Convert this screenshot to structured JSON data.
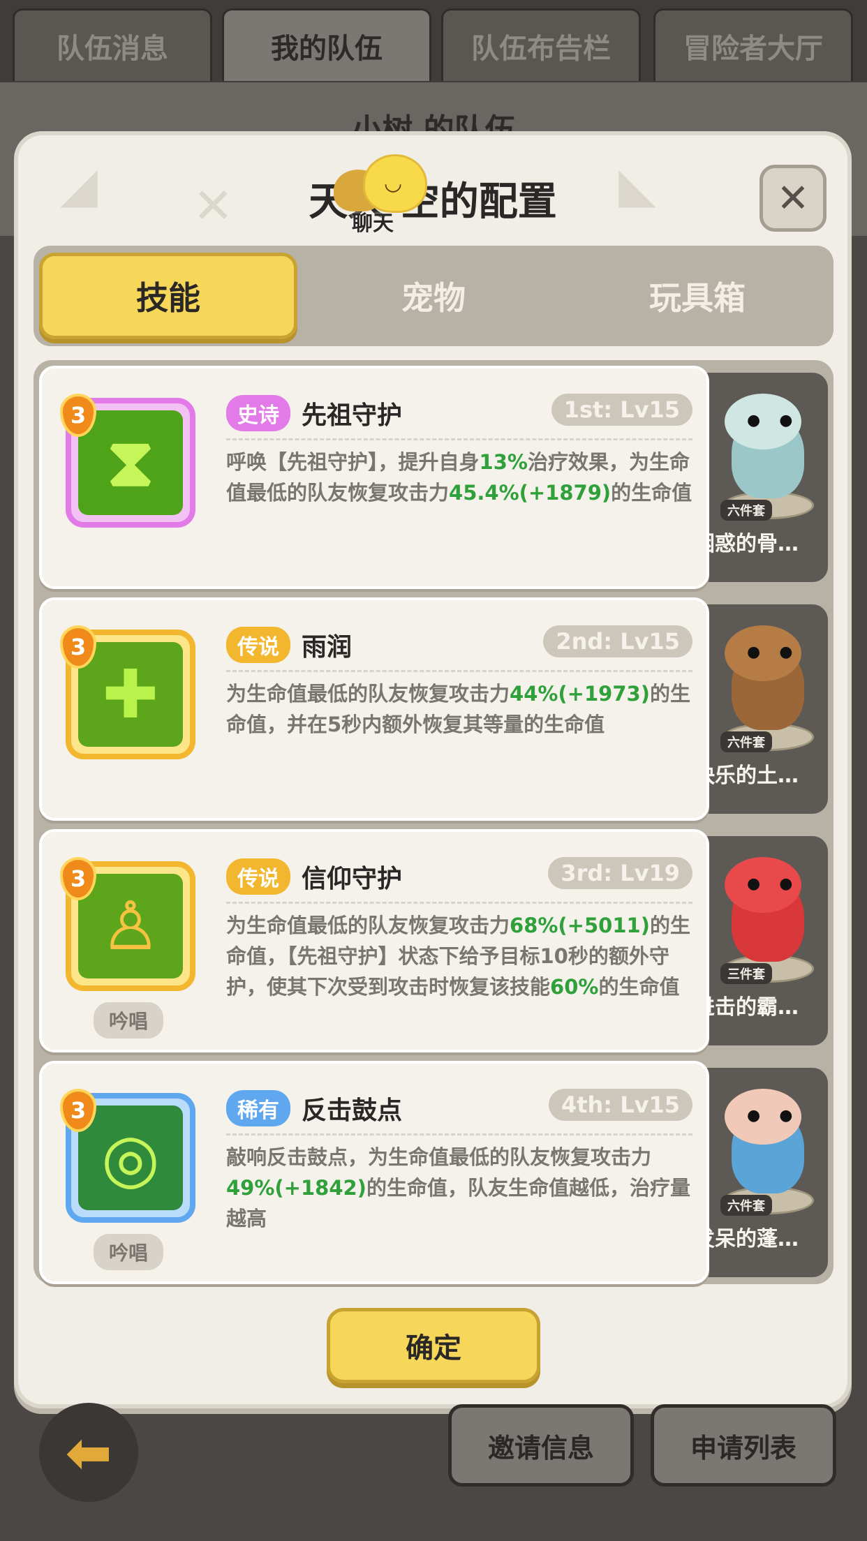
{
  "top_tabs": [
    {
      "label": "队伍消息"
    },
    {
      "label": "我的队伍"
    },
    {
      "label": "队伍布告栏"
    },
    {
      "label": "冒险者大厅"
    }
  ],
  "background_title": "小树 的队伍",
  "modal": {
    "title": "天天 空的配置",
    "close_label": "✕",
    "chat_label": "聊天"
  },
  "category_tabs": [
    {
      "label": "技能"
    },
    {
      "label": "宠物"
    },
    {
      "label": "玩具箱"
    }
  ],
  "skills": [
    {
      "level": "3",
      "rarity": "史诗",
      "name": "先祖守护",
      "rank": "1st: Lv15",
      "desc_parts": [
        "呼唤【先祖守护】，提升自身",
        "13%",
        "治疗效果，为生命值最低的队友恢复攻击力",
        "45.4%(+1879)",
        "的生命值"
      ],
      "chant": ""
    },
    {
      "level": "3",
      "rarity": "传说",
      "name": "雨润",
      "rank": "2nd: Lv15",
      "desc_parts": [
        "为生命值最低的队友恢复攻击力",
        "44%(+1973)",
        "的生命值，并在5秒内额外恢复其等量的生命值",
        "",
        ""
      ],
      "chant": ""
    },
    {
      "level": "3",
      "rarity": "传说",
      "name": "信仰守护",
      "rank": "3rd: Lv19",
      "desc_parts": [
        "为生命值最低的队友恢复攻击力",
        "68%(+5011)",
        "的生命值，【先祖守护】状态下给予目标10秒的额外守护，使其下次受到攻击时恢复该技能",
        "60%",
        "的生命值"
      ],
      "chant": "吟唱"
    },
    {
      "level": "3",
      "rarity": "稀有",
      "name": "反击鼓点",
      "rank": "4th: Lv15",
      "desc_parts": [
        "敲响反击鼓点，为生命值最低的队友恢复攻击力",
        "49%(+1842)",
        "的生命值，队友生命值越低，治疗量越高",
        "",
        ""
      ],
      "chant": "吟唱"
    }
  ],
  "pets": [
    {
      "name": "困惑的骨…",
      "set": "六件套"
    },
    {
      "name": "快乐的土…",
      "set": "六件套"
    },
    {
      "name": "进击的霸…",
      "set": "三件套"
    },
    {
      "name": "发呆的蓬…",
      "set": "六件套"
    }
  ],
  "confirm_label": "确定",
  "bottom_buttons": [
    {
      "label": "邀请信息"
    },
    {
      "label": "申请列表"
    }
  ],
  "colors": {
    "accent_yellow": "#f7d75a",
    "epic_purple": "#e27be8",
    "legend_gold": "#f2b72e",
    "rare_blue": "#5fa8f0",
    "value_green": "#2fa03a"
  }
}
